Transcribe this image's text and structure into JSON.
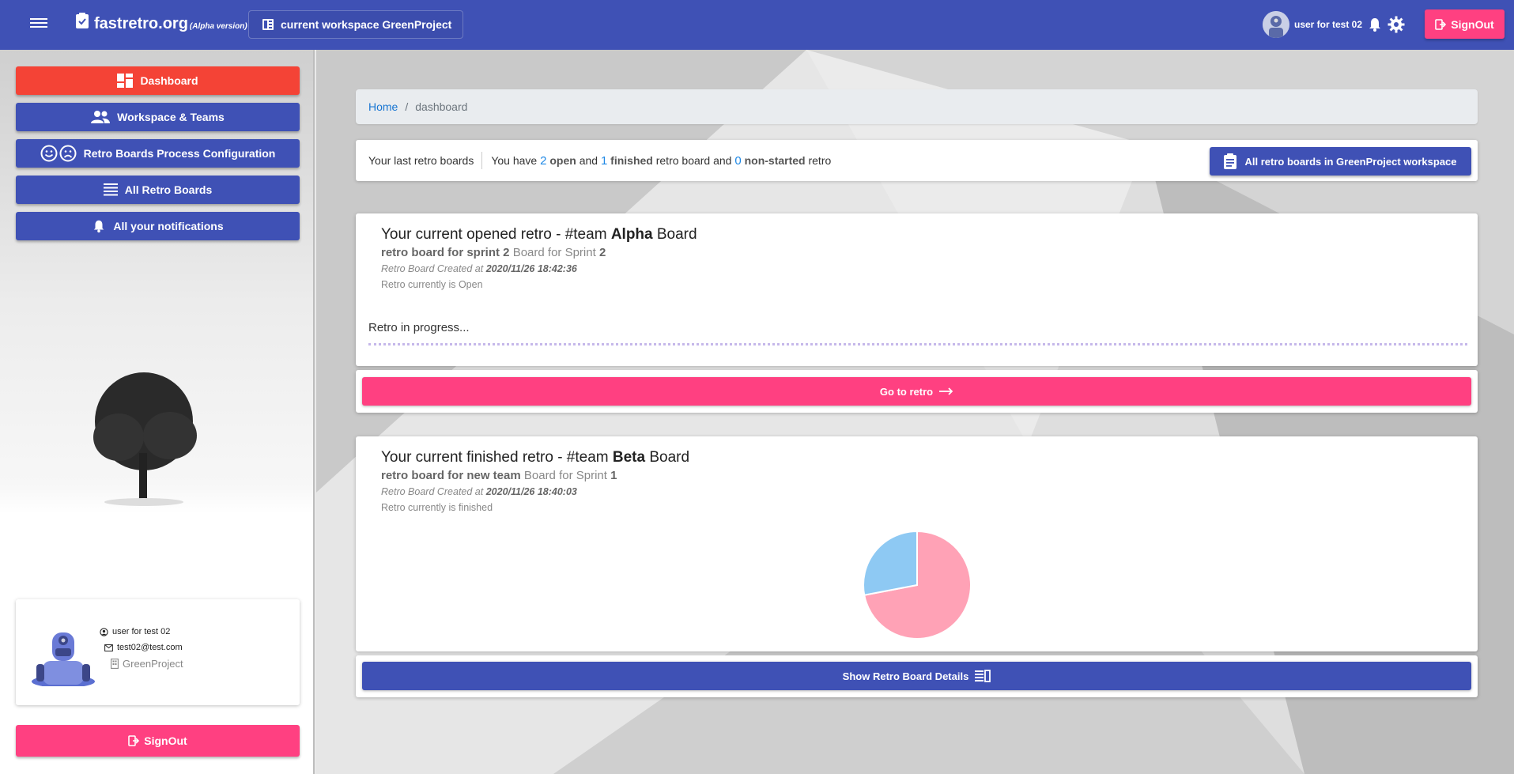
{
  "topbar": {
    "brand": "fastretro.org",
    "brand_tag": "(Alpha version)",
    "workspace_chip": "current workspace GreenProject",
    "user_name": "user for test 02",
    "signout_label": "SignOut"
  },
  "sidebar": {
    "items": [
      {
        "label": "Dashboard",
        "icon": "dashboard-icon",
        "active": true
      },
      {
        "label": "Workspace & Teams",
        "icon": "people-icon",
        "active": false
      },
      {
        "label": "Retro Boards Process Configuration",
        "icon": "smiley-faces-icon",
        "active": false
      },
      {
        "label": "All Retro Boards",
        "icon": "list-icon",
        "active": false
      },
      {
        "label": "All your notifications",
        "icon": "bell-icon",
        "active": false
      }
    ],
    "profile": {
      "name": "user for test 02",
      "email": "test02@test.com",
      "workspace": "GreenProject"
    },
    "signout_label": "SignOut"
  },
  "breadcrumb": {
    "home": "Home",
    "separator": "/",
    "current": "dashboard"
  },
  "summary": {
    "last_label": "Your last retro boards",
    "text_you_have": "You have",
    "open_count": "2",
    "open_label": "open",
    "text_and": "and",
    "finished_count": "1",
    "finished_label": "finished",
    "text_retro_board_and": "retro board and",
    "nonstarted_count": "0",
    "nonstarted_label": "non-started",
    "text_retro": "retro",
    "all_boards_button": "All retro boards in GreenProject workspace"
  },
  "opened_retro": {
    "title_prefix": "Your current opened retro - #team",
    "team": "Alpha",
    "title_suffix": "Board",
    "sub_bold": "retro board for sprint 2",
    "sub_text": "Board for Sprint",
    "sprint": "2",
    "created_label": "Retro Board Created at",
    "created_at": "2020/11/26 18:42:36",
    "status": "Retro currently is Open",
    "progress": "Retro in progress...",
    "go_button": "Go to retro"
  },
  "finished_retro": {
    "title_prefix": "Your current finished retro - #team",
    "team": "Beta",
    "title_suffix": "Board",
    "sub_bold": "retro board for new team",
    "sub_text": "Board for Sprint",
    "sprint": "1",
    "created_label": "Retro Board Created at",
    "created_at": "2020/11/26 18:40:03",
    "status": "Retro currently is finished",
    "details_button": "Show Retro Board Details"
  },
  "chart_data": {
    "type": "pie",
    "slices": [
      {
        "value": 72,
        "color": "#ffa2b6"
      },
      {
        "value": 28,
        "color": "#8ec9f3"
      }
    ]
  },
  "colors": {
    "primary": "#3f51b5",
    "accent": "#ff4081",
    "active": "#f44336",
    "link": "#1976d2"
  }
}
